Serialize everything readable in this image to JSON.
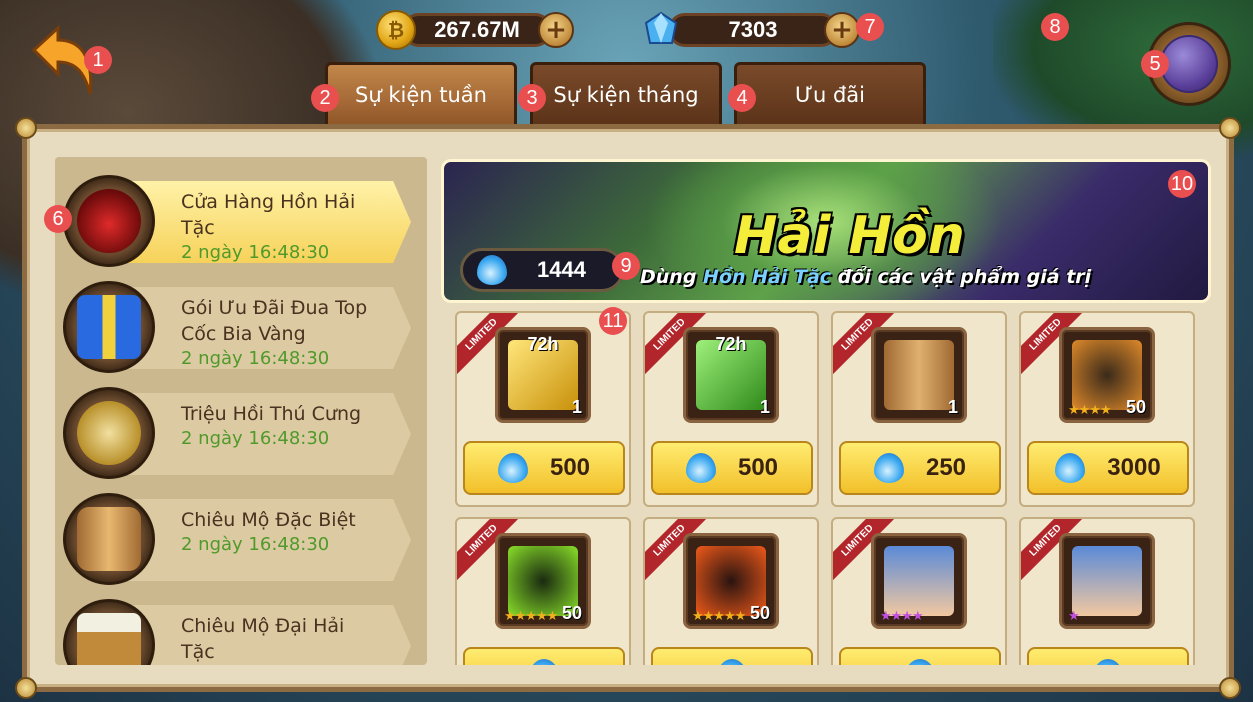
{
  "currency": {
    "coins": "267.67M",
    "gems": "7303"
  },
  "badges": [
    "1",
    "2",
    "3",
    "4",
    "5",
    "6",
    "7",
    "8",
    "9",
    "10",
    "11"
  ],
  "tabs": [
    {
      "label": "Sự kiện tuần",
      "active": true
    },
    {
      "label": "Sự kiện tháng",
      "active": false
    },
    {
      "label": "Ưu đãi",
      "active": false
    }
  ],
  "menu": [
    {
      "title": "Cửa Hàng Hồn Hải Tặc",
      "timer": "2 ngày 16:48:30",
      "icon": "skull-pirate-icon",
      "active": true
    },
    {
      "title": "Gói Ưu Đãi Đua Top Cốc Bia Vàng",
      "timer": "2 ngày 16:48:30",
      "icon": "gift-box-icon",
      "active": false
    },
    {
      "title": "Triệu Hồi Thú Cưng",
      "timer": "2 ngày 16:48:30",
      "icon": "compass-icon",
      "active": false
    },
    {
      "title": "Chiêu Mộ Đặc Biệt",
      "timer": "2 ngày 16:48:30",
      "icon": "barrel-icon",
      "active": false
    },
    {
      "title": "Chiêu Mộ Đại Hải Tặc",
      "timer": "",
      "icon": "beer-mug-icon",
      "active": false
    }
  ],
  "banner": {
    "title": "Hải Hồn",
    "subtitle_pre": "Dùng ",
    "subtitle_highlight": "Hồn Hải Tặc",
    "subtitle_post": " đổi các vật phẩm giá trị",
    "soul_count": "1444"
  },
  "ribbon_text": "LIMITED",
  "items": [
    {
      "name": "gold-chest",
      "duration": "72h",
      "qty": "1",
      "price": "500",
      "art": "linear-gradient(135deg,#ffe67a,#c8900a)",
      "stars": ""
    },
    {
      "name": "jade-chest",
      "duration": "72h",
      "qty": "1",
      "price": "500",
      "art": "linear-gradient(135deg,#9ef07a,#2f8a1a)",
      "stars": ""
    },
    {
      "name": "barrel",
      "duration": "",
      "qty": "1",
      "price": "250",
      "art": "linear-gradient(90deg,#a06a32,#e0b070,#a06a32)",
      "stars": ""
    },
    {
      "name": "pirate-hat-shard",
      "duration": "",
      "qty": "50",
      "price": "3000",
      "art": "radial-gradient(circle,#3a2a1a,#e08a2a)",
      "stars": "★★★★"
    },
    {
      "name": "green-pirate-shard",
      "duration": "",
      "qty": "50",
      "price": "",
      "art": "radial-gradient(circle,#1a2a10,#8ae02a)",
      "stars": "★★★★★"
    },
    {
      "name": "red-pirate-shard",
      "duration": "",
      "qty": "50",
      "price": "",
      "art": "radial-gradient(circle,#2a1410,#f05a1a)",
      "stars": "★★★★★"
    },
    {
      "name": "captain-portrait-a",
      "duration": "",
      "qty": "",
      "price": "",
      "art": "linear-gradient(#5a8ad8,#f2c8a0)",
      "stars": "★★★★"
    },
    {
      "name": "captain-portrait-b",
      "duration": "",
      "qty": "",
      "price": "",
      "art": "linear-gradient(#5a8ad8,#f2c8a0)",
      "stars": "★"
    }
  ]
}
